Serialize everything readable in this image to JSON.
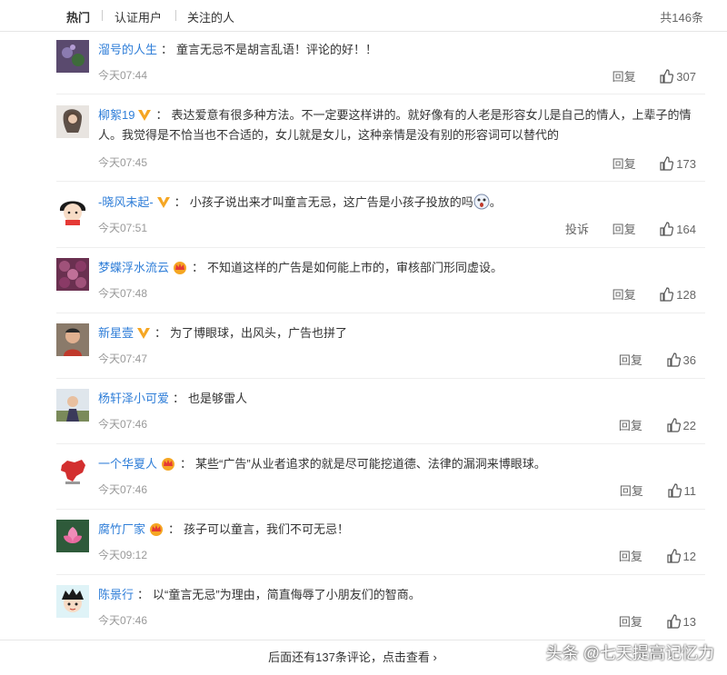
{
  "tabs": [
    "热门",
    "认证用户",
    "关注的人"
  ],
  "total": "共146条",
  "comments": [
    {
      "user": "溜号的人生",
      "text": "童言无忌不是胡言乱语！评论的好！！",
      "time": "今天07:44",
      "reply": "回复",
      "likes": "307",
      "badge": ""
    },
    {
      "user": "柳絮19",
      "text": "表达爱意有很多种方法。不一定要这样讲的。就好像有的人老是形容女儿是自己的情人，上辈子的情人。我觉得是不恰当也不合适的，女儿就是女儿，这种亲情是没有别的形容词可以替代的",
      "time": "今天07:45",
      "reply": "回复",
      "likes": "173",
      "badge": "v-icon"
    },
    {
      "user": "-晓风未起-",
      "text": "小孩子说出来才叫童言无忌，这广告是小孩子投放的吗",
      "text_end": "。",
      "time": "今天07:51",
      "report": "投诉",
      "reply": "回复",
      "likes": "164",
      "badge": "v-icon"
    },
    {
      "user": "梦蝶浮水流云",
      "text": "不知道这样的广告是如何能上市的，审核部门形同虚设。",
      "time": "今天07:48",
      "reply": "回复",
      "likes": "128",
      "badge": "crown-icon"
    },
    {
      "user": "新星壹",
      "text": "为了博眼球，出风头，广告也拼了",
      "time": "今天07:47",
      "reply": "回复",
      "likes": "36",
      "badge": "v-icon"
    },
    {
      "user": "杨轩泽小可爱",
      "text": "也是够雷人",
      "time": "今天07:46",
      "reply": "回复",
      "likes": "22",
      "badge": ""
    },
    {
      "user": "一个华夏人",
      "text": "某些“广告”从业者追求的就是尽可能挖道德、法律的漏洞来博眼球。",
      "time": "今天07:46",
      "reply": "回复",
      "likes": "11",
      "badge": "crown-icon"
    },
    {
      "user": "腐竹厂家",
      "text": "孩子可以童言，我们不可无忌！",
      "time": "今天09:12",
      "reply": "回复",
      "likes": "12",
      "badge": "crown-icon"
    },
    {
      "user": "陈景行",
      "text": "以“童言无忌”为理由，简直侮辱了小朋友们的智商。",
      "time": "今天07:46",
      "reply": "回复",
      "likes": "13",
      "badge": ""
    }
  ],
  "more_link": "后面还有137条评论，点击查看",
  "watermark": "头条 @七天提高记忆力",
  "colors": {
    "link": "#2f7ed8",
    "badge": "#f5a623",
    "muted": "#999999"
  }
}
